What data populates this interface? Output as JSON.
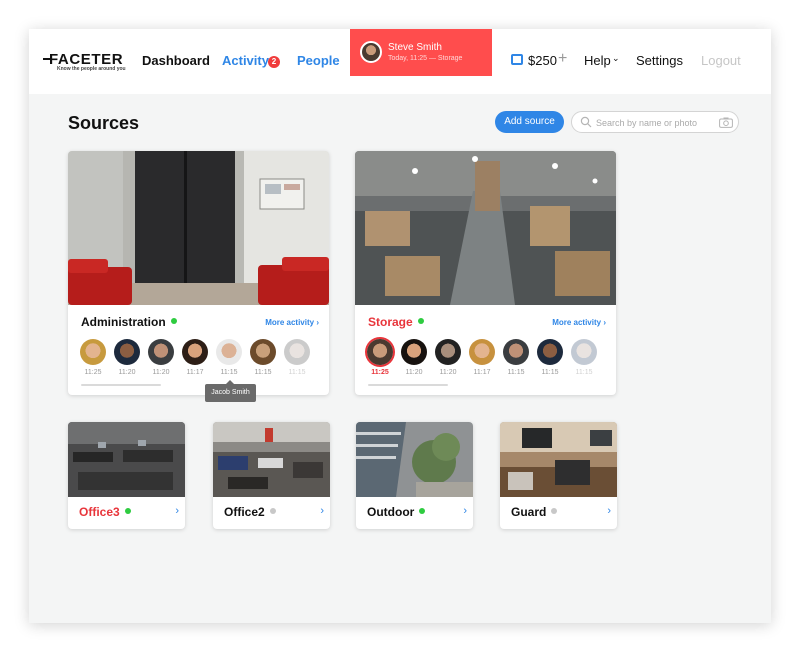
{
  "brand": {
    "name": "FACETER",
    "tagline": "Know the people around you"
  },
  "nav": {
    "dashboard": "Dashboard",
    "activity": "Activity",
    "activity_badge": "2",
    "people": "People"
  },
  "notification": {
    "name": "Steve Smith",
    "subtitle": "Today, 11:25 — Storage"
  },
  "account": {
    "balance": "$250",
    "add_funds_symbol": "+",
    "help": "Help",
    "settings": "Settings",
    "logout": "Logout"
  },
  "page": {
    "title": "Sources",
    "add_source": "Add source",
    "search_placeholder": "Search by name or photo"
  },
  "colors": {
    "accent": "#2f86e6",
    "alert": "#ff4d4d",
    "online": "#2ecc40",
    "offline": "#c8c8c8"
  },
  "sources_main": [
    {
      "name": "Administration",
      "name_color": "#111111",
      "status": "online",
      "more": "More activity",
      "times": [
        "11:25",
        "11:20",
        "11:20",
        "11:17",
        "11:15",
        "11:15",
        "11:15"
      ]
    },
    {
      "name": "Storage",
      "name_color": "#e8353b",
      "status": "online",
      "more": "More activity",
      "times": [
        "11:25",
        "11:20",
        "11:20",
        "11:17",
        "11:15",
        "11:15",
        "11:15"
      ]
    }
  ],
  "tooltip": "Jacob Smith",
  "sources_small": [
    {
      "name": "Office3",
      "name_color": "#e8353b",
      "status": "online"
    },
    {
      "name": "Office2",
      "name_color": "#111111",
      "status": "offline"
    },
    {
      "name": "Outdoor",
      "name_color": "#111111",
      "status": "online"
    },
    {
      "name": "Guard",
      "name_color": "#111111",
      "status": "offline"
    }
  ]
}
